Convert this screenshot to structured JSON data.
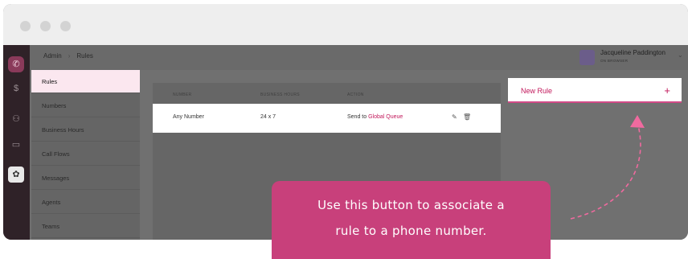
{
  "breadcrumb": {
    "root": "Admin",
    "separator": "›",
    "current": "Rules"
  },
  "user": {
    "name": "Jacqueline Paddington",
    "status": "ON BROWSER"
  },
  "iconbar": {
    "items": [
      {
        "name": "phone-logo-icon",
        "glyph": "✆"
      },
      {
        "name": "dollar-icon",
        "glyph": "$"
      },
      {
        "name": "people-icon",
        "glyph": "⚇"
      },
      {
        "name": "id-card-icon",
        "glyph": "▭"
      },
      {
        "name": "gear-icon",
        "glyph": "✿"
      }
    ]
  },
  "sidebar": {
    "items": [
      {
        "label": "Rules",
        "active": true
      },
      {
        "label": "Numbers"
      },
      {
        "label": "Business Hours"
      },
      {
        "label": "Call Flows"
      },
      {
        "label": "Messages"
      },
      {
        "label": "Agents"
      },
      {
        "label": "Teams"
      }
    ]
  },
  "table": {
    "headers": [
      "NUMBER",
      "BUSINESS HOURS",
      "ACTION"
    ],
    "rows": [
      {
        "number": "Any Number",
        "hours": "24 x 7",
        "action_prefix": "Send to",
        "action_link": "Global Queue"
      }
    ]
  },
  "new_rule": {
    "label": "New Rule",
    "plus": "+"
  },
  "tooltip": {
    "line1": "Use this button to associate a",
    "line2": "rule to a phone number."
  },
  "colors": {
    "accent": "#c2185b",
    "tooltip_bg": "#c8407b",
    "active_item_bg": "#fbe7ef"
  }
}
